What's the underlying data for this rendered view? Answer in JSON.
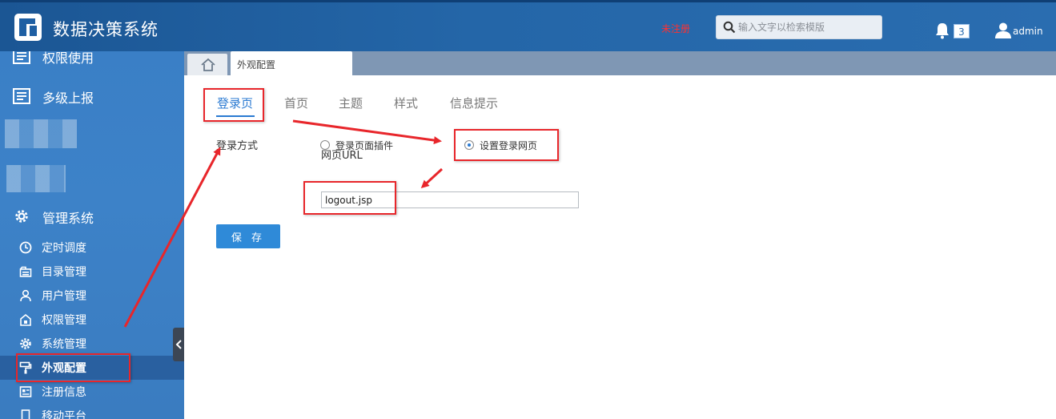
{
  "header": {
    "app_title": "数据决策系统",
    "unregistered": "未注册",
    "search_placeholder": "输入文字以检索模版",
    "notification_count": "3",
    "username": "admin"
  },
  "sidebar": {
    "groups": [
      {
        "label": "权限使用",
        "icon": "document-list-icon"
      },
      {
        "label": "多级上报",
        "icon": "document-list-icon"
      },
      {
        "label": "管理系统",
        "icon": "gear-icon"
      }
    ],
    "items": [
      {
        "label": "定时调度",
        "icon": "clock-icon"
      },
      {
        "label": "目录管理",
        "icon": "folder-icon"
      },
      {
        "label": "用户管理",
        "icon": "user-icon"
      },
      {
        "label": "权限管理",
        "icon": "lock-icon"
      },
      {
        "label": "系统管理",
        "icon": "gear-icon"
      },
      {
        "label": "外观配置",
        "icon": "paint-roller-icon",
        "active": true
      },
      {
        "label": "注册信息",
        "icon": "register-icon"
      },
      {
        "label": "移动平台",
        "icon": "mobile-icon"
      }
    ]
  },
  "tabbar": {
    "page_tab": "外观配置"
  },
  "content": {
    "tabs": [
      {
        "label": "登录页",
        "active": true
      },
      {
        "label": "首页"
      },
      {
        "label": "主题"
      },
      {
        "label": "样式"
      },
      {
        "label": "信息提示"
      }
    ],
    "login_method_label": "登录方式",
    "options": [
      {
        "label": "登录页面插件",
        "checked": false
      },
      {
        "label": "设置登录网页",
        "checked": true
      }
    ],
    "url_label": "网页URL",
    "url_value": "logout.jsp",
    "save_label": "保 存"
  },
  "colors": {
    "header": "#2466a8",
    "sidebar": "#3d82c8",
    "accent": "#2a7ad2",
    "annotation": "#e8262b"
  }
}
